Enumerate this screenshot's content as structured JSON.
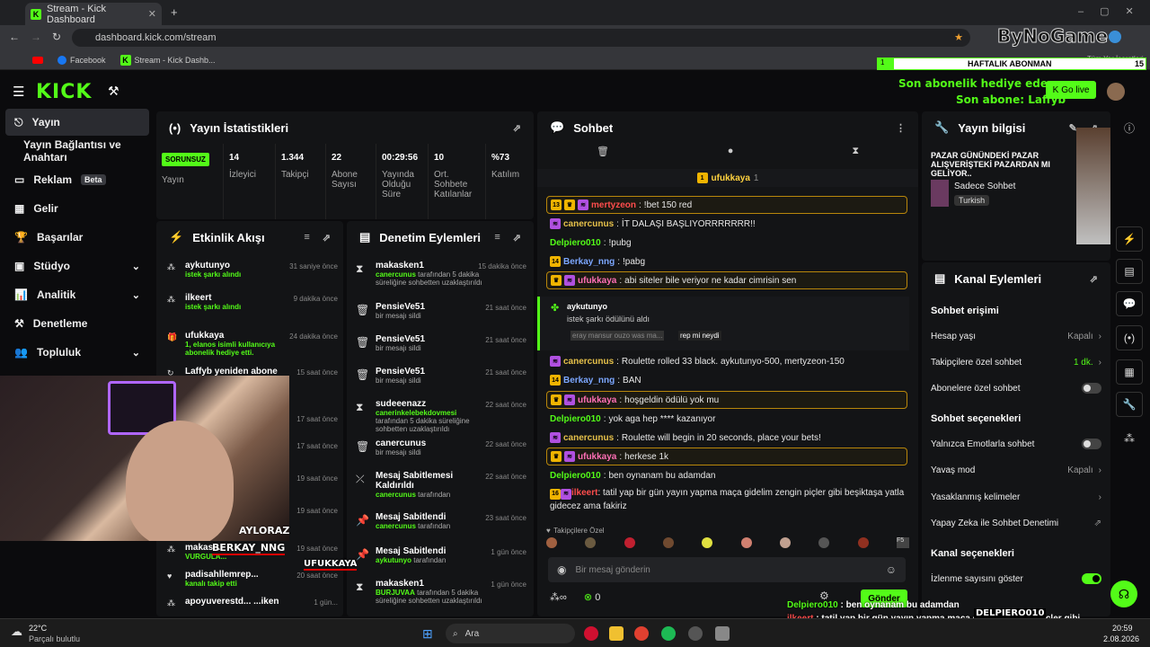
{
  "browser": {
    "tab_title": "Stream - Kick Dashboard",
    "url": "dashboard.kick.com/stream",
    "bookmarks": [
      "Facebook",
      "Stream - Kick Dashb..."
    ],
    "bookmarks_right": "Tüm Yer İşaretleri"
  },
  "sidebar": {
    "items": [
      {
        "label": "Yayın",
        "active": true
      },
      {
        "label": "Yayın Bağlantısı ve Anahtarı"
      },
      {
        "label": "Reklam",
        "badge": "Beta"
      },
      {
        "label": "Gelir"
      },
      {
        "label": "Başarılar"
      },
      {
        "label": "Stüdyo"
      },
      {
        "label": "Analitik"
      },
      {
        "label": "Denetleme"
      },
      {
        "label": "Topluluk"
      }
    ]
  },
  "stats": {
    "title": "Yayın İstatistikleri",
    "status_badge": "SORUNSUZ",
    "status_label": "Yayın",
    "items": [
      {
        "value": "14",
        "label": "İzleyici"
      },
      {
        "value": "1.344",
        "label": "Takipçi"
      },
      {
        "value": "22",
        "label": "Abone Sayısı"
      },
      {
        "value": "00:29:56",
        "label": "Yayında Olduğu Süre"
      },
      {
        "value": "10",
        "label": "Ort. Sohbete Katılanlar"
      },
      {
        "value": "%73",
        "label": "Katılım"
      }
    ]
  },
  "activity": {
    "title": "Etkinlik Akışı",
    "events": [
      {
        "name": "aykutunyo",
        "sub": "istek şarkı alındı",
        "time": "31 saniye önce"
      },
      {
        "name": "ilkeert",
        "sub": "istek şarkı alındı",
        "time": "9 dakika önce"
      },
      {
        "name": "ufukkaya",
        "sub": "1, elanos isimli kullanıcıya abonelik hediye etti.",
        "time": "24 dakika önce"
      },
      {
        "name": "Laffyb yeniden abone",
        "sub": "",
        "time": "15 saat önce"
      },
      {
        "name": "",
        "sub": "",
        "time": "17 saat önce"
      },
      {
        "name": "",
        "sub": "",
        "time": "17 saat önce"
      },
      {
        "name": "",
        "sub": "",
        "time": "19 saat önce"
      },
      {
        "name": "",
        "sub": "",
        "time": "19 saat önce"
      },
      {
        "name": "makas...",
        "sub": "VURGULA...",
        "time": "19 saat önce"
      },
      {
        "name": "padisahllemrep...",
        "sub": "kanalı takip etti",
        "time": "20 saat önce"
      },
      {
        "name": "apoyuverestd... ...iken",
        "sub": "",
        "time": "1 gün..."
      }
    ]
  },
  "moderation": {
    "title": "Denetim Eylemleri",
    "actions": [
      {
        "name": "makasken1",
        "who": "canercunus",
        "detail": "tarafından 5 dakika süreliğine sohbetten uzaklaştırıldı",
        "time": "15 dakika önce",
        "icon": "hourglass"
      },
      {
        "name": "PensieVe51",
        "who": "",
        "detail": "bir mesajı sildi",
        "time": "21 saat önce",
        "icon": "trash"
      },
      {
        "name": "PensieVe51",
        "who": "",
        "detail": "bir mesajı sildi",
        "time": "21 saat önce",
        "icon": "trash"
      },
      {
        "name": "PensieVe51",
        "who": "",
        "detail": "bir mesajı sildi",
        "time": "21 saat önce",
        "icon": "trash"
      },
      {
        "name": "sudeeenazz",
        "who": "canerinkelebekdovmesi",
        "detail": "tarafından 5 dakika süreliğine sohbetten uzaklaştırıldı",
        "time": "22 saat önce",
        "icon": "hourglass"
      },
      {
        "name": "canercunus",
        "who": "",
        "detail": "bir mesajı sildi",
        "time": "22 saat önce",
        "icon": "trash"
      },
      {
        "name": "Mesaj Sabitlemesi Kaldırıldı",
        "who": "canercunus",
        "detail": "tarafından",
        "time": "22 saat önce",
        "icon": "unpin"
      },
      {
        "name": "Mesaj Sabitlendi",
        "who": "canercunus",
        "detail": "tarafından",
        "time": "23 saat önce",
        "icon": "pin"
      },
      {
        "name": "Mesaj Sabitlendi",
        "who": "aykutunyo",
        "detail": "tarafından",
        "time": "1 gün önce",
        "icon": "pin"
      },
      {
        "name": "makasken1",
        "who": "BURJUVAA",
        "detail": "tarafından 5 dakika süreliğine sohbetten uzaklaştırıldı",
        "time": "1 gün önce",
        "icon": "hourglass"
      }
    ]
  },
  "chat": {
    "title": "Sohbet",
    "pinned_user": "ufukkaya",
    "pinned_count": "1",
    "messages": [
      {
        "user": "mertyzeon",
        "color": "#ff4d4d",
        "text": "!bet 150 red",
        "hl": true,
        "badge": "13"
      },
      {
        "user": "canercunus",
        "color": "#e6c14a",
        "text": "İT DALAŞI BAŞLIYORRRRRRR!!",
        "hl": false
      },
      {
        "user": "Delpiero010",
        "color": "#53fc18",
        "text": "!pubg",
        "hl": false
      },
      {
        "user": "Berkay_nng",
        "color": "#7ca7ff",
        "text": "!pabg",
        "hl": false,
        "badge": "14"
      },
      {
        "user": "ufukkaya",
        "color": "#ff6fb5",
        "text": "abi siteler bile veriyor ne kadar cimrisin sen",
        "hl": true
      },
      {
        "user": "canercunus",
        "color": "#e6c14a",
        "text": "Roulette rolled 33 black. aykutunyo-500, mertyzeon-150",
        "hl": false
      },
      {
        "user": "Berkay_nng",
        "color": "#7ca7ff",
        "text": "BAN",
        "hl": false,
        "badge": "14"
      },
      {
        "user": "ufukkaya",
        "color": "#ff6fb5",
        "text": "hoşgeldin ödülü yok mu",
        "hl": true
      },
      {
        "user": "Delpiero010",
        "color": "#53fc18",
        "text": "yok aga hep **** kazanıyor",
        "hl": false
      },
      {
        "user": "canercunus",
        "color": "#e6c14a",
        "text": "Roulette will begin in 20 seconds, place your bets!",
        "hl": false
      },
      {
        "user": "ufukkaya",
        "color": "#ff6fb5",
        "text": "herkese 1k",
        "hl": true
      },
      {
        "user": "Delpiero010",
        "color": "#53fc18",
        "text": "ben oynanam bu adamdan",
        "hl": false
      },
      {
        "user": "ilkeert",
        "color": "#ff4d4d",
        "text": "tatil yap bir gün yayın yapma maça gidelim zengin piçler gibi beşiktaşa yatla gidecez ama fakiriz",
        "hl": false,
        "badge": "16"
      }
    ],
    "reward": {
      "user": "aykutunyo",
      "title": "istek şarkı ödülünü aldı",
      "quote": "eray mansur ouzo was ma...",
      "reply": "rep mi neydi"
    },
    "followers_only": "Takipçilere Özel",
    "input_placeholder": "Bir mesaj gönderin",
    "send_label": "Gönder",
    "points": "0"
  },
  "stream_info": {
    "title": "Yayın bilgisi",
    "stream_title": "PAZAR GÜNÜNDEKİ PAZAR ALIŞVERİŞTEKİ PAZARDAN MI GELİYOR..",
    "category": "Sadece Sohbet",
    "language": "Turkish"
  },
  "channel_actions": {
    "title": "Kanal Eylemleri",
    "chat_access": "Sohbet erişimi",
    "rows_access": [
      {
        "label": "Hesap yaşı",
        "value": "Kapalı"
      },
      {
        "label": "Takipçilere özel sohbet",
        "value": "1 dk."
      },
      {
        "label": "Abonelere özel sohbet",
        "value": ""
      }
    ],
    "chat_options": "Sohbet seçenekleri",
    "rows_options": [
      {
        "label": "Yalnızca Emotlarla sohbet",
        "value": ""
      },
      {
        "label": "Yavaş mod",
        "value": "Kapalı"
      },
      {
        "label": "Yasaklanmış kelimeler",
        "value": ""
      },
      {
        "label": "Yapay Zeka ile Sohbet Denetimi",
        "value": ""
      }
    ],
    "channel_options": "Kanal seçenekleri",
    "rows_channel": [
      {
        "label": "İzlenme sayısını göster",
        "value": ""
      }
    ]
  },
  "overlays": {
    "weekly_label": "HAFTALIK ABONMAN",
    "weekly_left": "1",
    "weekly_right": "15",
    "gift_text": "Son abonelik hediye eden: ...a",
    "last_sub": "Son abone: Laffyb",
    "go_live": "Go live",
    "watermark": "ByNoGame",
    "names": [
      "AYLORAZ",
      "BERKAY_NNG",
      "UFUKKAYA",
      "DELPIERO010"
    ],
    "chat_line1_user": "Delpiero010",
    "chat_line1_text": "ben oynanam bu adamdan",
    "chat_line2_user": "ilkeert",
    "chat_line2_text": "tatil yap bir gün yayın yapma maça gidelim zengin piçler gibi beşiktaşa yatla gidecez ama fakiriz"
  },
  "taskbar": {
    "temp": "22°C",
    "weather": "Parçalı bulutlu",
    "search": "Ara",
    "time": "20:59",
    "date": "2.08.2026"
  }
}
